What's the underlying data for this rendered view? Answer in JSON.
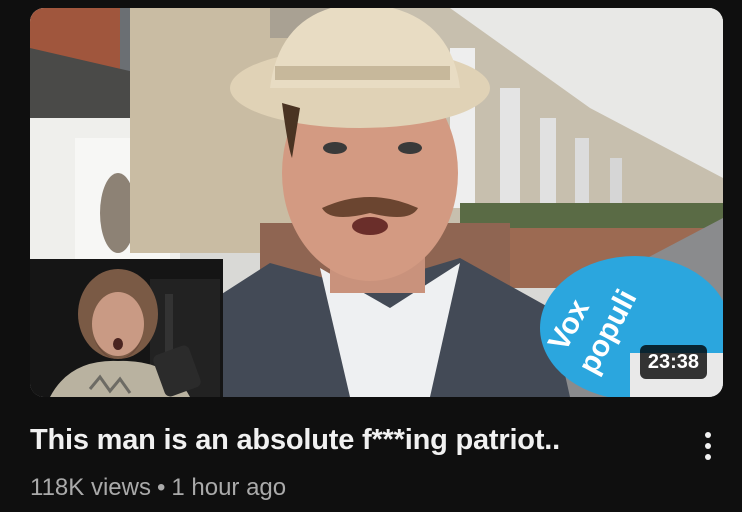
{
  "video": {
    "title": "This man is an absolute f***ing patriot..",
    "views": "118K views",
    "separator": "•",
    "age": "1 hour ago",
    "duration": "23:38",
    "mic_text_line1": "Vox",
    "mic_text_line2": "populi"
  },
  "icons": {
    "more": "vertical-ellipsis-icon"
  },
  "colors": {
    "background": "#0f0f0f",
    "title_text": "#f1f1f1",
    "meta_text": "#aaaaaa",
    "mic_blue": "#2ba6de"
  }
}
